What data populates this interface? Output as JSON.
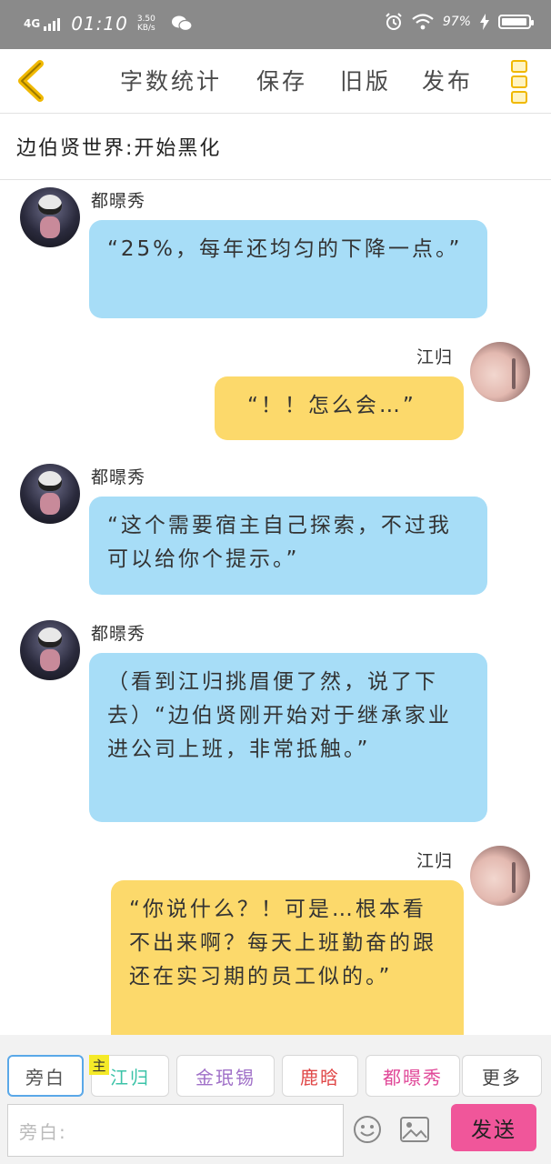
{
  "status_bar": {
    "network": "4G",
    "time": "01:10",
    "speed_value": "3.50",
    "speed_unit": "KB/s",
    "battery": "97%",
    "battery_level": 0.97
  },
  "toolbar": {
    "word_count": "字数统计",
    "save": "保存",
    "old_version": "旧版",
    "publish": "发布"
  },
  "title": "边伯贤世界:开始黑化",
  "messages": [
    {
      "speaker": "都暻秀",
      "side": "left",
      "text": "“25%，每年还均匀的下降一点。”"
    },
    {
      "speaker": "江归",
      "side": "right",
      "text": "“！！怎么会…”"
    },
    {
      "speaker": "都暻秀",
      "side": "left",
      "text": "“这个需要宿主自己探索，不过我可以给你个提示。”"
    },
    {
      "speaker": "都暻秀",
      "side": "left",
      "text": "（看到江归挑眉便了然，说了下去）“边伯贤刚开始对于继承家业进公司上班，非常抵触。”"
    },
    {
      "speaker": "江归",
      "side": "right",
      "text": "“你说什么？！可是…根本看不出来啊？每天上班勤奋的跟还在实习期的员工似的。”"
    }
  ],
  "roles": [
    {
      "label": "旁白",
      "color": "#555555"
    },
    {
      "label": "江归",
      "color": "#3cc3a8",
      "tag": "主"
    },
    {
      "label": "金珉锡",
      "color": "#a070c8"
    },
    {
      "label": "鹿晗",
      "color": "#e04848"
    },
    {
      "label": "都暻秀",
      "color": "#e04898"
    },
    {
      "label": "更多",
      "color": "#444444"
    }
  ],
  "input": {
    "placeholder": "旁白:"
  },
  "send_label": "发送",
  "colors": {
    "blue_bubble": "#a7ddf7",
    "yellow_bubble": "#fcd96b",
    "send": "#f0569a",
    "accent": "#f0b800"
  }
}
